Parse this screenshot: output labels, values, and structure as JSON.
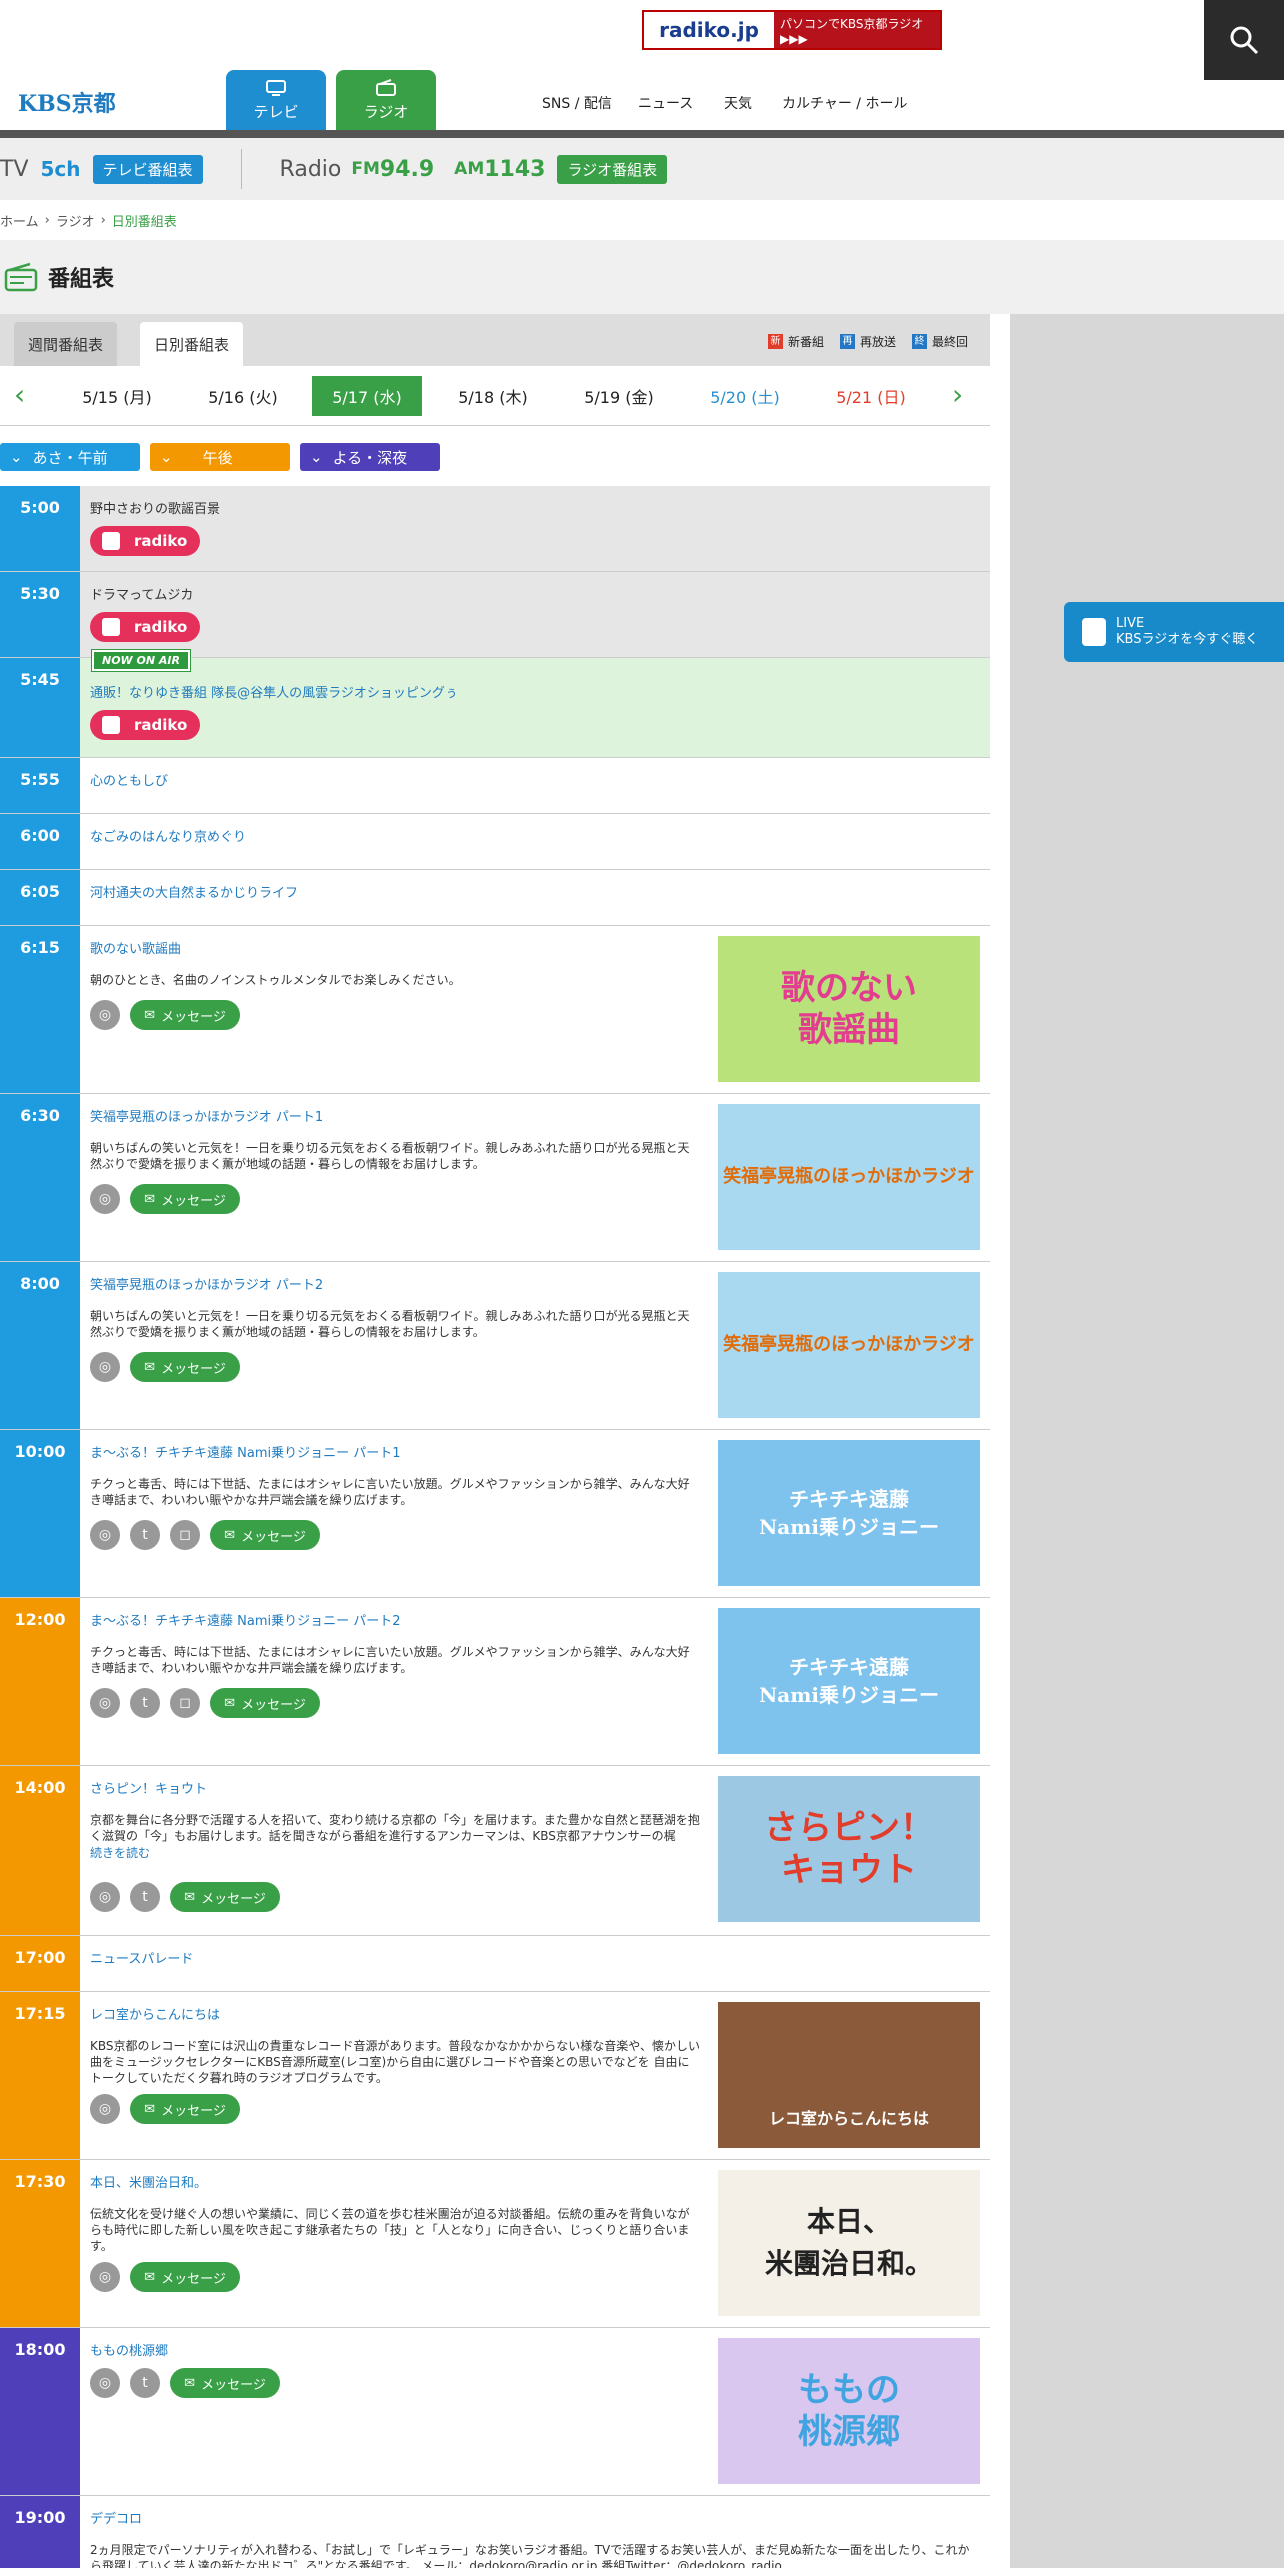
{
  "header": {
    "radiko_banner_logo": "radiko.jp",
    "radiko_banner_text": "パソコンでKBS京都ラジオ ▶▶▶",
    "logo": "KBS京都",
    "tabs": [
      {
        "label": "テレビ"
      },
      {
        "label": "ラジオ"
      }
    ],
    "nav": [
      "SNS / 配信",
      "ニュース",
      "天気",
      "カルチャー / ホール"
    ]
  },
  "station": {
    "tv_label": "TV",
    "tv_ch": "5ch",
    "tv_btn": "テレビ番組表",
    "radio_label": "Radio",
    "fm_prefix": "FM",
    "fm_freq": "94.9",
    "am_prefix": "AM",
    "am_freq": "1143",
    "radio_btn": "ラジオ番組表"
  },
  "breadcrumb": [
    "ホーム",
    "ラジオ",
    "日別番組表"
  ],
  "page_title": "番組表",
  "view_tabs": [
    {
      "label": "週間番組表"
    },
    {
      "label": "日別番組表"
    }
  ],
  "legend": [
    {
      "mark": "新",
      "label": "新番組",
      "color": "#e23d2b"
    },
    {
      "mark": "再",
      "label": "再放送",
      "color": "#2577c6"
    },
    {
      "mark": "終",
      "label": "最終回",
      "color": "#2577c6"
    }
  ],
  "dates": [
    "5/15 (月)",
    "5/16 (火)",
    "5/17 (水)",
    "5/18 (木)",
    "5/19 (金)",
    "5/20 (土)",
    "5/21 (日)"
  ],
  "time_filters": [
    "あさ・午前",
    "午後",
    "よる・深夜"
  ],
  "live": {
    "line1": "LIVE",
    "line2": "KBSラジオを今すぐ聴く"
  },
  "radiko_label": "radiko",
  "message_label": "メッセージ",
  "now_on_air": "NOW ON AIR",
  "read_more": "続きを読む",
  "colors": {
    "morning": "#1f9be0",
    "afternoon": "#f39800",
    "night": "#4f3fb8",
    "green": "#3aa047",
    "onair_bg": "#def3db"
  },
  "programs": [
    {
      "time": "5:00",
      "title": "野中さおりの歌謡百景"
    },
    {
      "time": "5:30",
      "title": "ドラマってムジカ"
    },
    {
      "time": "5:45",
      "title": "通販！なりゆき番組 隊長@谷隼人の風雲ラジオショッピングぅ"
    },
    {
      "time": "5:55",
      "title": "心のともしび"
    },
    {
      "time": "6:00",
      "title": "なごみのはんなり京めぐり"
    },
    {
      "time": "6:05",
      "title": "河村通夫の大自然まるかじりライフ"
    },
    {
      "time": "6:15",
      "title": "歌のない歌謡曲",
      "desc": "朝のひととき、名曲のノインストゥルメンタルでお楽しみください。",
      "image_text": "歌のない\n歌謡曲"
    },
    {
      "time": "6:30",
      "title": "笑福亭晃瓶のほっかほかラジオ パート1",
      "desc": "朝いちばんの笑いと元気を！一日を乗り切る元気をおくる看板朝ワイド。親しみあふれた語り口が光る晃瓶と天然ぶりで愛嬌を振りまく薫が地域の話題・暮らしの情報をお届けします。",
      "image_text": "笑福亭晃瓶のほっかほかラジオ"
    },
    {
      "time": "8:00",
      "title": "笑福亭晃瓶のほっかほかラジオ パート2",
      "desc": "朝いちばんの笑いと元気を！一日を乗り切る元気をおくる看板朝ワイド。親しみあふれた語り口が光る晃瓶と天然ぶりで愛嬌を振りまく薫が地域の話題・暮らしの情報をお届けします。",
      "image_text": "笑福亭晃瓶のほっかほかラジオ"
    },
    {
      "time": "10:00",
      "title": "ま～ぶる！チキチキ遠藤 Nami乗りジョニー パート1",
      "desc": "チクっと毒舌、時には下世話、たまにはオシャレに言いたい放題。グルメやファッションから雑学、みんな大好き噂話まで、わいわい賑やかな井戸端会議を繰り広げます。",
      "image_text": "チキチキ遠藤\nNami乗りジョニー"
    },
    {
      "time": "12:00",
      "title": "ま～ぶる！チキチキ遠藤 Nami乗りジョニー パート2",
      "desc": "チクっと毒舌、時には下世話、たまにはオシャレに言いたい放題。グルメやファッションから雑学、みんな大好き噂話まで、わいわい賑やかな井戸端会議を繰り広げます。",
      "image_text": "チキチキ遠藤\nNami乗りジョニー"
    },
    {
      "time": "14:00",
      "title": "さらピン！キョウト",
      "desc": "京都を舞台に各分野で活躍する人を招いて、変わり続ける京都の「今」を届けます。また豊かな自然と琵琶湖を抱く滋賀の「今」もお届けします。話を聞きながら番組を進行するアンカーマンは、KBS京都アナウンサーの梶",
      "image_text": "さらピン！\nキョウト"
    },
    {
      "time": "17:00",
      "title": "ニュースパレード"
    },
    {
      "time": "17:15",
      "title": "レコ室からこんにちは",
      "desc": "KBS京都のレコード室には沢山の貴重なレコード音源があります。普段なかなかかからない様な音楽や、懐かしい曲をミュージックセレクターにKBS音源所蔵室(レコ室)から自由に選びレコードや音楽との思いでなどを 自由にトークしていただく夕暮れ時のラジオプログラムです。",
      "image_text": "レコ室からこんにちは"
    },
    {
      "time": "17:30",
      "title": "本日、米團治日和。",
      "desc": "伝統文化を受け継ぐ人の想いや業績に、同じく芸の道を歩む桂米團治が迫る対談番組。伝統の重みを背負いながらも時代に即した新しい風を吹き起こす継承者たちの「技」と「人となり」に向き合い、じっくりと語り合います。",
      "image_text": "本日、\n米團治日和。"
    },
    {
      "time": "18:00",
      "title": "ももの桃源郷",
      "image_text": "ももの\n桃源郷"
    },
    {
      "time": "19:00",
      "title": "デデコロ",
      "desc": "2ヵ月限定でパーソナリティが入れ替わる、「お試し」で「レギュラー」なお笑いラジオ番組。TVで活躍するお笑い芸人が、まだ見ぬ新たな一面を出したり、これから飛躍していく芸人達の新たな出ドコ゛ろ\"となる番組です。 メール：dedokoro@radio.or.jp 番組Twitter：@dedokoro_radio"
    }
  ]
}
